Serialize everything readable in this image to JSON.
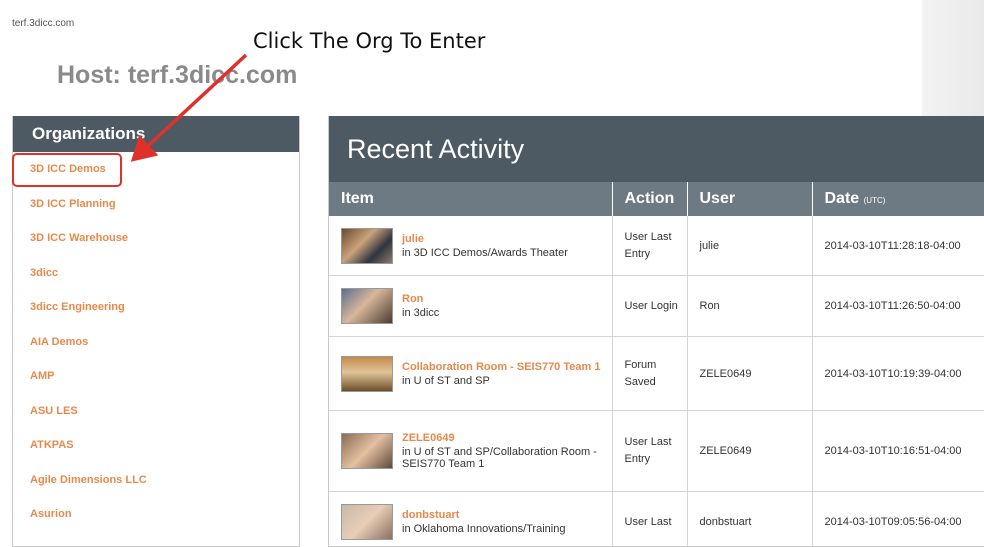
{
  "site_url": "terf.3dicc.com",
  "annotation_text": "Click The Org To Enter",
  "host_label": "Host: terf.3dicc.com",
  "sidebar": {
    "title": "Organizations",
    "items": [
      "3D ICC Demos",
      "3D ICC Planning",
      "3D ICC Warehouse",
      "3dicc",
      "3dicc Engineering",
      "AIA Demos",
      "AMP",
      "ASU LES",
      "ATKPAS",
      "Agile Dimensions LLC",
      "Asurion"
    ]
  },
  "activity": {
    "title": "Recent Activity",
    "columns": {
      "item": "Item",
      "action": "Action",
      "user": "User",
      "date": "Date",
      "date_unit": "(UTC)"
    },
    "rows": [
      {
        "title": "julie",
        "location": "in 3D ICC Demos/Awards Theater",
        "action": "User Last Entry",
        "user": "julie",
        "date": "2014-03-10T11:28:18-04:00"
      },
      {
        "title": "Ron",
        "location": "in 3dicc",
        "action": "User Login",
        "user": "Ron",
        "date": "2014-03-10T11:26:50-04:00"
      },
      {
        "title": "Collaboration Room - SEIS770 Team 1",
        "location": "in U of ST and SP",
        "action": "Forum Saved",
        "user": "ZELE0649",
        "date": "2014-03-10T10:19:39-04:00"
      },
      {
        "title": "ZELE0649",
        "location": "in U of ST and SP/Collaboration Room - SEIS770 Team 1",
        "action": "User Last Entry",
        "user": "ZELE0649",
        "date": "2014-03-10T10:16:51-04:00"
      },
      {
        "title": "donbstuart",
        "location": "in Oklahoma Innovations/Training",
        "action": "User Last",
        "user": "donbstuart",
        "date": "2014-03-10T09:05:56-04:00"
      }
    ]
  },
  "colors": {
    "header_bg": "#4d5a63",
    "column_bg": "#6d7983",
    "link": "#e8894c",
    "annotation": "#e0302a"
  }
}
